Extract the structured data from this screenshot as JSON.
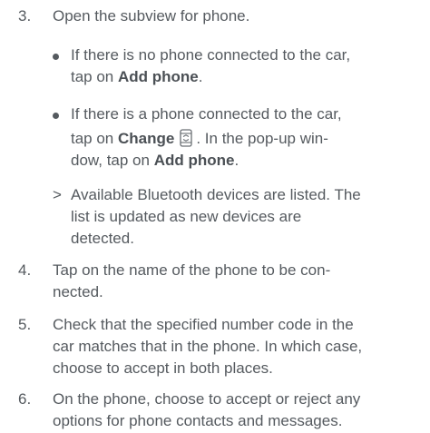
{
  "steps": [
    {
      "num": "3.",
      "text": "Open the subview for phone."
    },
    {
      "num": "4.",
      "line1": "Tap on the name of the phone to be con-",
      "line2": "nected."
    },
    {
      "num": "5.",
      "line1": "Check that the specified number code in the",
      "line2": "car matches that in the phone. In which case,",
      "line3": "choose to accept in both places."
    },
    {
      "num": "6.",
      "line1": "On the phone, choose to accept or reject any",
      "line2": "options for phone contacts and messages."
    }
  ],
  "bullets": [
    {
      "line1": "If there is no phone connected to the car,",
      "line2_pre": "tap on ",
      "line2_bold": "Add phone",
      "line2_post": "."
    },
    {
      "line1": "If there is a phone connected to the car,",
      "line2_pre": "tap on ",
      "line2_bold": "Change",
      "line2_post": ". In the pop-up win-",
      "line3_pre": "dow, tap on ",
      "line3_bold": "Add phone",
      "line3_post": "."
    }
  ],
  "result": {
    "marker": ">",
    "line1": "Available Bluetooth devices are listed. The",
    "line2": "list is updated as new devices are",
    "line3": "detected."
  },
  "icons": {
    "change": "change-phone-icon"
  }
}
